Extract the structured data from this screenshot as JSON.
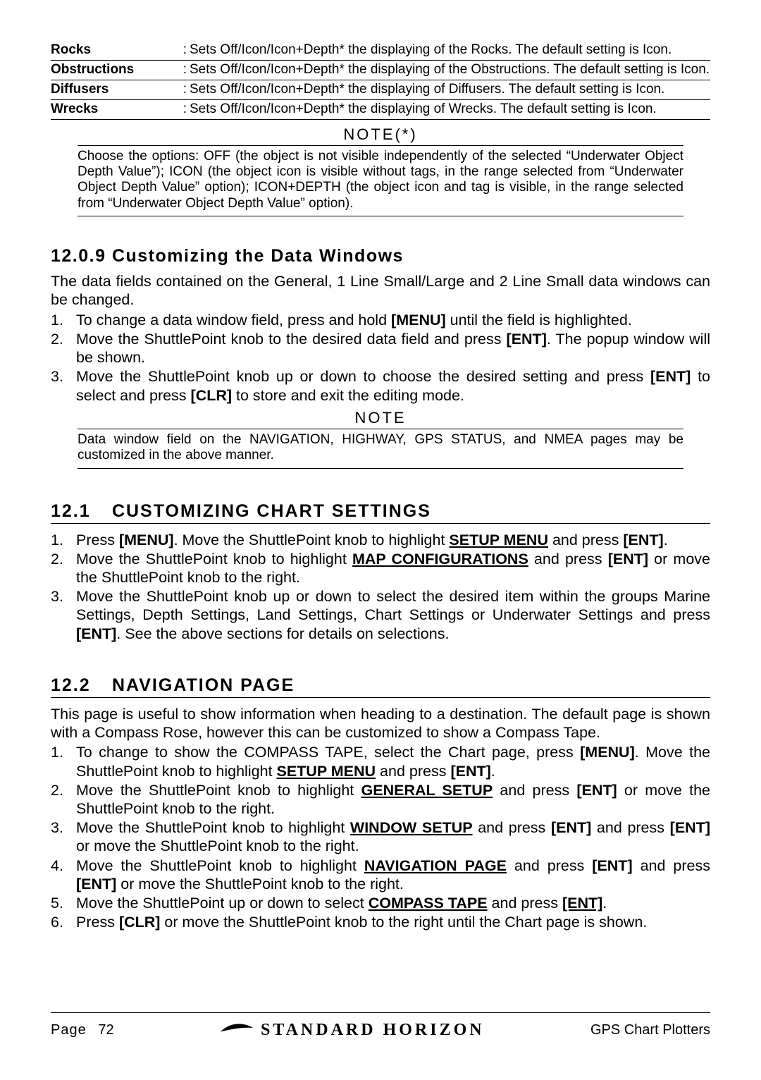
{
  "defs": [
    {
      "term": "Rocks",
      "desc": "Sets Off/Icon/Icon+Depth* the displaying of the Rocks. The default setting is Icon."
    },
    {
      "term": "Obstructions",
      "desc": "Sets Off/Icon/Icon+Depth* the displaying of the Obstructions. The default setting is Icon."
    },
    {
      "term": "Diffusers",
      "desc": "Sets Off/Icon/Icon+Depth* the displaying of Diffusers. The default setting is Icon."
    },
    {
      "term": "Wrecks",
      "desc": "Sets Off/Icon/Icon+Depth* the displaying of Wrecks. The default setting is Icon."
    }
  ],
  "note1": {
    "head": "NOTE(*)",
    "body": "Choose the options: OFF (the object is not visible independently of the selected “Underwater Object Depth Value”); ICON (the object icon is visible without tags, in the range selected from “Underwater Object Depth Value” option); ICON+DEPTH (the object icon and tag is visible, in the range selected from “Underwater Object Depth Value” option)."
  },
  "sec1209": {
    "head": "12.0.9 Customizing the Data Windows",
    "lead": "The data fields contained on the General, 1 Line Small/Large and 2 Line Small data windows can be changed.",
    "steps": [
      {
        "pre": "To change a data window field, press and hold ",
        "k1": "[MENU]",
        "post": " until the field is highlighted."
      },
      {
        "pre": "Move the ShuttlePoint knob to the desired data field and press ",
        "k1": "[ENT]",
        "post": ". The popup window will be shown."
      },
      {
        "pre": "Move the ShuttlePoint knob up or down to choose the desired setting and press ",
        "k1": "[ENT]",
        "mid": " to select and press ",
        "k2": "[CLR]",
        "post": " to store and exit the editing mode."
      }
    ]
  },
  "note2": {
    "head": "NOTE",
    "body": "Data window field on the NAVIGATION, HIGHWAY, GPS STATUS, and NMEA pages may be customized in the above manner."
  },
  "sec121": {
    "num": "12.1",
    "title": "CUSTOMIZING CHART SETTINGS",
    "steps": [
      {
        "t1": "Press ",
        "k1": "[MENU]",
        "t2": ". Move the ShuttlePoint knob to highlight ",
        "u1": "SETUP MENU",
        "t3": " and press ",
        "k2": "[ENT]",
        "t4": "."
      },
      {
        "t1": "Move the ShuttlePoint knob to highlight ",
        "u1": "MAP CONFIGURATIONS",
        "t2": " and press ",
        "k1": "[ENT]",
        "t3": " or move the ShuttlePoint knob to the right."
      },
      {
        "t1": "Move the ShuttlePoint knob up or down to select the desired item within the groups Marine Settings, Depth Settings, Land Settings, Chart Settings or Underwater Settings and press ",
        "k1": "[ENT]",
        "t2": ". See the above sections for details on selections."
      }
    ]
  },
  "sec122": {
    "num": "12.2",
    "title": "NAVIGATION PAGE",
    "lead": "This page is useful to show information when heading to a destination. The default page is shown with a Compass Rose, however this can be customized to show a Compass Tape.",
    "steps": [
      {
        "t1": "To change to show the COMPASS TAPE, select the Chart page, press ",
        "k1": "[MENU]",
        "t2": ". Move the ShuttlePoint knob to highlight ",
        "u1": "SETUP MENU",
        "t3": " and press ",
        "k2": "[ENT]",
        "t4": "."
      },
      {
        "t1": "Move the ShuttlePoint knob to highlight ",
        "u1": "GENERAL SETUP",
        "t2": " and press ",
        "k1": "[ENT]",
        "t3": " or move the ShuttlePoint knob to the right."
      },
      {
        "t1": "Move the ShuttlePoint knob to highlight ",
        "u1": "WINDOW SETUP",
        "t2": " and press ",
        "k1": "[ENT]",
        "t3": " and press ",
        "k2": "[ENT]",
        "t4": " or move the ShuttlePoint knob to the right."
      },
      {
        "t1": "Move the ShuttlePoint knob to highlight ",
        "u1": "NAVIGATION PAGE",
        "t2": " and press ",
        "k1": "[ENT]",
        "t3": " and press ",
        "k2": "[ENT]",
        "t4": " or move the ShuttlePoint knob to the right."
      },
      {
        "t1": "Move the ShuttlePoint up or down to select ",
        "u1": "COMPASS TAPE",
        "t2": " and press ",
        "ku": "[ENT]",
        "t3": "."
      },
      {
        "t1": "Press ",
        "k1": "[CLR]",
        "t2": " or move the ShuttlePoint knob to the right until the Chart page is shown."
      }
    ]
  },
  "footer": {
    "left_label": "Page",
    "page_no": "72",
    "brand": "STANDARD HORIZON",
    "right": "GPS Chart Plotters"
  }
}
